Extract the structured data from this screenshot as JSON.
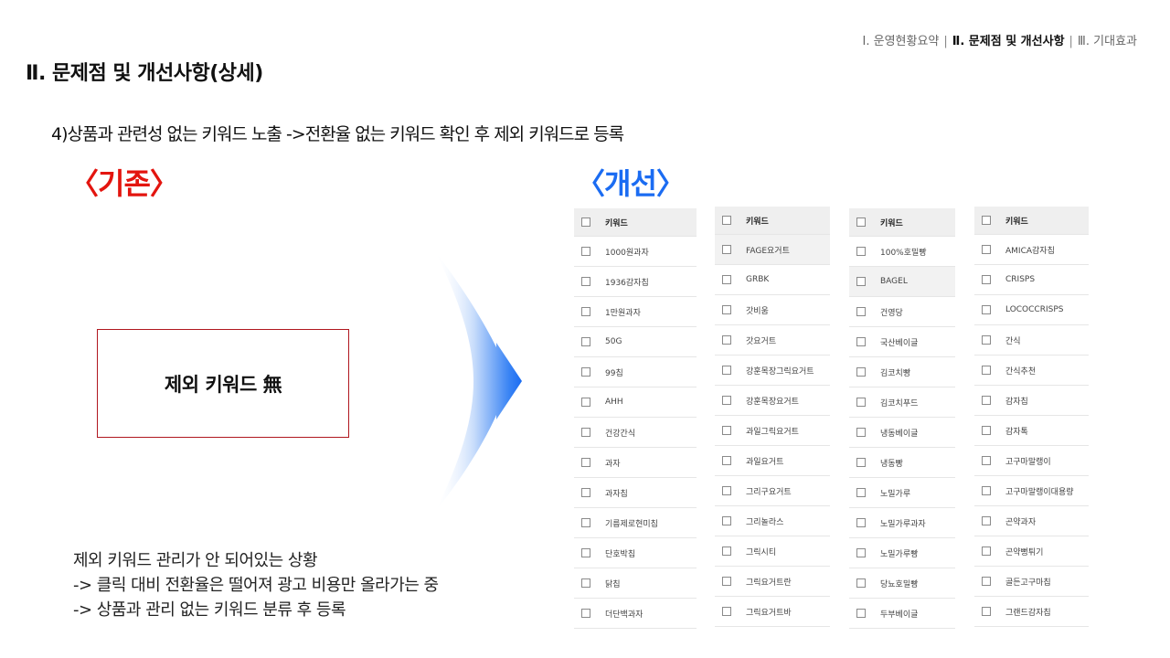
{
  "breadcrumb": {
    "item1": "Ⅰ. 운영현황요약",
    "item2": "Ⅱ. 문제점 및 개선사항",
    "item3": "Ⅲ. 기대효과"
  },
  "title": "Ⅱ. 문제점 및 개선사항(상세)",
  "subtitle": "4)상품과 관련성 없는 키워드 노출 ->전환율 없는 키워드 확인 후 제외 키워드로 등록",
  "before": {
    "label": "〈기존〉",
    "box_text": "제외 키워드 無"
  },
  "after": {
    "label": "〈개선〉"
  },
  "notes": [
    "제외 키워드 관리가 안 되어있는 상황",
    "-> 클릭 대비 전환율은 떨어져 광고 비용만 올라가는 중",
    "-> 상품과 관리 없는 키워드 분류 후 등록"
  ],
  "tables": [
    {
      "header": "키워드",
      "rows": [
        "1000원과자",
        "1936감자칩",
        "1만원과자",
        "50G",
        "99칩",
        "AHH",
        "건강간식",
        "과자",
        "과자칩",
        "기름제로현미칩",
        "단호박칩",
        "닭칩",
        "더단백과자"
      ],
      "shaded": []
    },
    {
      "header": "키워드",
      "rows": [
        "FAGE요거트",
        "GRBK",
        "갓비움",
        "갓요거트",
        "강훈목장그릭요거트",
        "강훈목장요거트",
        "과일그릭요거트",
        "과일요거트",
        "그리구요거트",
        "그리놀라스",
        "그릭시티",
        "그릭요거트란",
        "그릭요거트바"
      ],
      "shaded": [
        0
      ]
    },
    {
      "header": "키워드",
      "rows": [
        "100%호밀빵",
        "BAGEL",
        "건영당",
        "국산베이글",
        "김코치빵",
        "김코치푸드",
        "냉동베이글",
        "냉동빵",
        "노밀가루",
        "노밀가루과자",
        "노밀가루빵",
        "당뇨호밀빵",
        "두부베이글"
      ],
      "shaded": [
        1
      ]
    },
    {
      "header": "키워드",
      "rows": [
        "AMICA감자칩",
        "CRISPS",
        "LOCOCCRISPS",
        "간식",
        "간식추천",
        "감자칩",
        "감자톡",
        "고구마말랭이",
        "고구마말랭이대용량",
        "곤약과자",
        "곤약뻥튀기",
        "골든고구마칩",
        "그랜드감자칩"
      ],
      "shaded": []
    }
  ]
}
